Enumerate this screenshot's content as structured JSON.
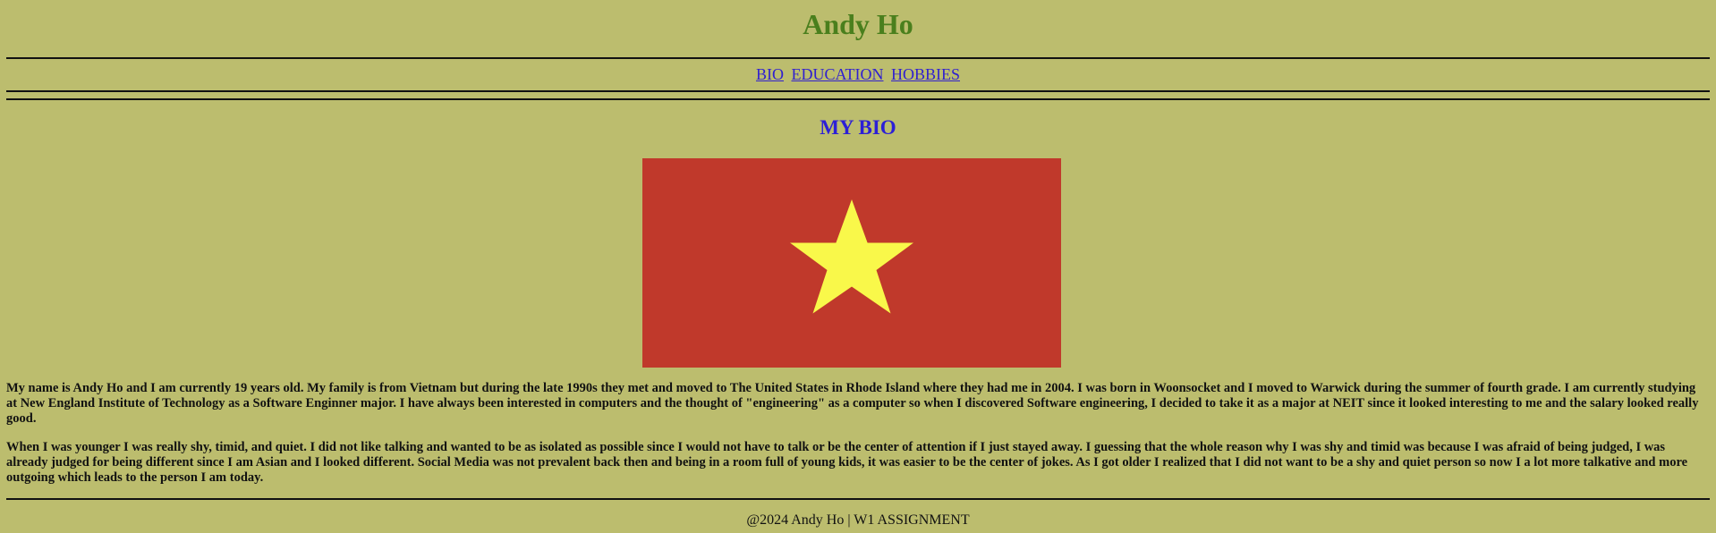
{
  "header": {
    "title": "Andy Ho"
  },
  "nav": {
    "items": [
      {
        "label": "BIO"
      },
      {
        "label": "EDUCATION"
      },
      {
        "label": "HOBBIES"
      }
    ]
  },
  "bio": {
    "heading": "MY BIO",
    "image": {
      "icon": "vietnam-flag",
      "background_color": "#c0392b",
      "star_color": "#f9f84a"
    },
    "paragraphs": [
      "My name is Andy Ho and I am currently 19 years old. My family is from Vietnam but during the late 1990s they met and moved to The United States in Rhode Island where they had me in 2004. I was born in Woonsocket and I moved to Warwick during the summer of fourth grade. I am currently studying at New England Institute of Technology as a Software Enginner major. I have always been interested in computers and the thought of \"engineering\" as a computer so when I discovered Software engineering, I decided to take it as a major at NEIT since it looked interesting to me and the salary looked really good.",
      "When I was younger I was really shy, timid, and quiet. I did not like talking and wanted to be as isolated as possible since I would not have to talk or be the center of attention if I just stayed away. I guessing that the whole reason why I was shy and timid was because I was afraid of being judged, I was already judged for being different since I am Asian and I looked different. Social Media was not prevalent back then and being in a room full of young kids, it was easier to be the center of jokes. As I got older I realized that I did not want to be a shy and quiet person so now I a lot more talkative and more outgoing which leads to the person I am today."
    ]
  },
  "footer": {
    "text": "@2024 Andy Ho | W1 ASSIGNMENT"
  },
  "colors": {
    "page_background": "#bcbd6e",
    "title": "#4a7f1d",
    "link": "#2f1fd0",
    "section_heading": "#2c1fd6"
  }
}
